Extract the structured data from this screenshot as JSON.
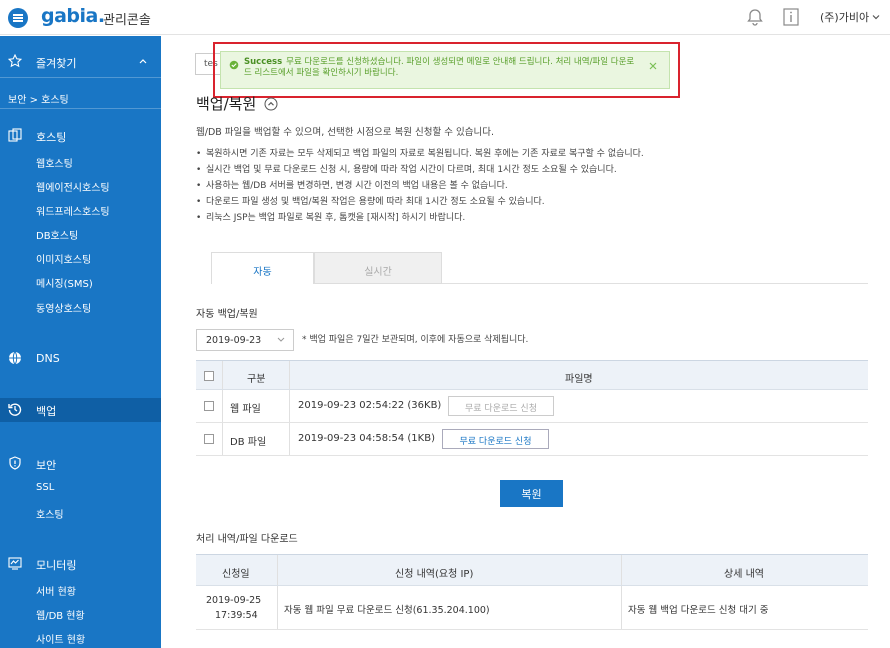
{
  "header": {
    "logo": "gabia.",
    "console_title": "관리콘솔",
    "company": "(주)가비아"
  },
  "sidebar": {
    "favorites": "즐겨찾기",
    "breadcrumb": "보안 > 호스팅",
    "sections": [
      {
        "label": "호스팅",
        "icon": "hosting-icon",
        "items": [
          "웹호스팅",
          "웹에이전시호스팅",
          "워드프레스호스팅",
          "DB호스팅",
          "이미지호스팅",
          "메시징(SMS)",
          "동영상호스팅"
        ]
      },
      {
        "label": "DNS",
        "icon": "globe-icon",
        "items": []
      },
      {
        "label": "백업",
        "icon": "backup-icon",
        "items": []
      },
      {
        "label": "보안",
        "icon": "shield-icon",
        "items": [
          "SSL",
          "호스팅"
        ]
      },
      {
        "label": "모니터링",
        "icon": "monitor-icon",
        "items": [
          "서버 현황",
          "웹/DB 현황",
          "사이트 현황"
        ]
      }
    ],
    "active": "백업"
  },
  "content": {
    "select_stub": "tes",
    "toast": {
      "title": "Success",
      "message": "무료 다운로드를 신청하셨습니다. 파일이 생성되면 메일로 안내해 드립니다. 처리 내역/파일 다운로드 리스트에서 파일을 확인하시기 바랍니다."
    },
    "page_title": "백업/복원",
    "intro": "웹/DB 파일을 백업할 수 있으며, 선택한 시점으로 복원 신청할 수 있습니다.",
    "bullets": [
      "복원하시면 기존 자료는 모두 삭제되고 백업 파일의 자료로 복원됩니다. 복원 후에는 기존 자료로 복구할 수 없습니다.",
      "실시간 백업 및 무료 다운로드 신청 시, 용량에 따라 작업 시간이 다르며, 최대 1시간 정도 소요될 수 있습니다.",
      "사용하는 웹/DB 서버를 변경하면, 변경 시간 이전의 백업 내용은 볼 수 없습니다.",
      "다운로드 파일 생성 및 백업/복원 작업은 용량에 따라 최대 1시간 정도 소요될 수 있습니다.",
      "리눅스 JSP는 백업 파일로 복원 후, 톰캣을 [재시작] 하시기 바랍니다."
    ],
    "tabs": {
      "auto": "자동",
      "realtime": "실시간"
    },
    "auto_section_label": "자동 백업/복원",
    "date_select": "2019-09-23",
    "date_note": "* 백업 파일은 7일간 보관되며, 이후에 자동으로 삭제됩니다.",
    "backup_table": {
      "headers": {
        "type": "구분",
        "file": "파일명"
      },
      "rows": [
        {
          "type": "웹 파일",
          "file": "2019-09-23 02:54:22 (36KB)",
          "button": "무료 다운로드 신청"
        },
        {
          "type": "DB 파일",
          "file": "2019-09-23 04:58:54 (1KB)",
          "button": "무료 다운로드 신청"
        }
      ]
    },
    "restore_button": "복원",
    "history_label": "처리 내역/파일 다운로드",
    "history_table": {
      "headers": {
        "date": "신청일",
        "request": "신청 내역(요청 IP)",
        "detail": "상세 내역"
      },
      "rows": [
        {
          "date_line1": "2019-09-25",
          "date_line2": "17:39:54",
          "request": "자동 웹 파일 무료 다운로드 신청(61.35.204.100)",
          "detail": "자동 웹 백업 다운로드 신청 대기 중"
        }
      ]
    }
  }
}
